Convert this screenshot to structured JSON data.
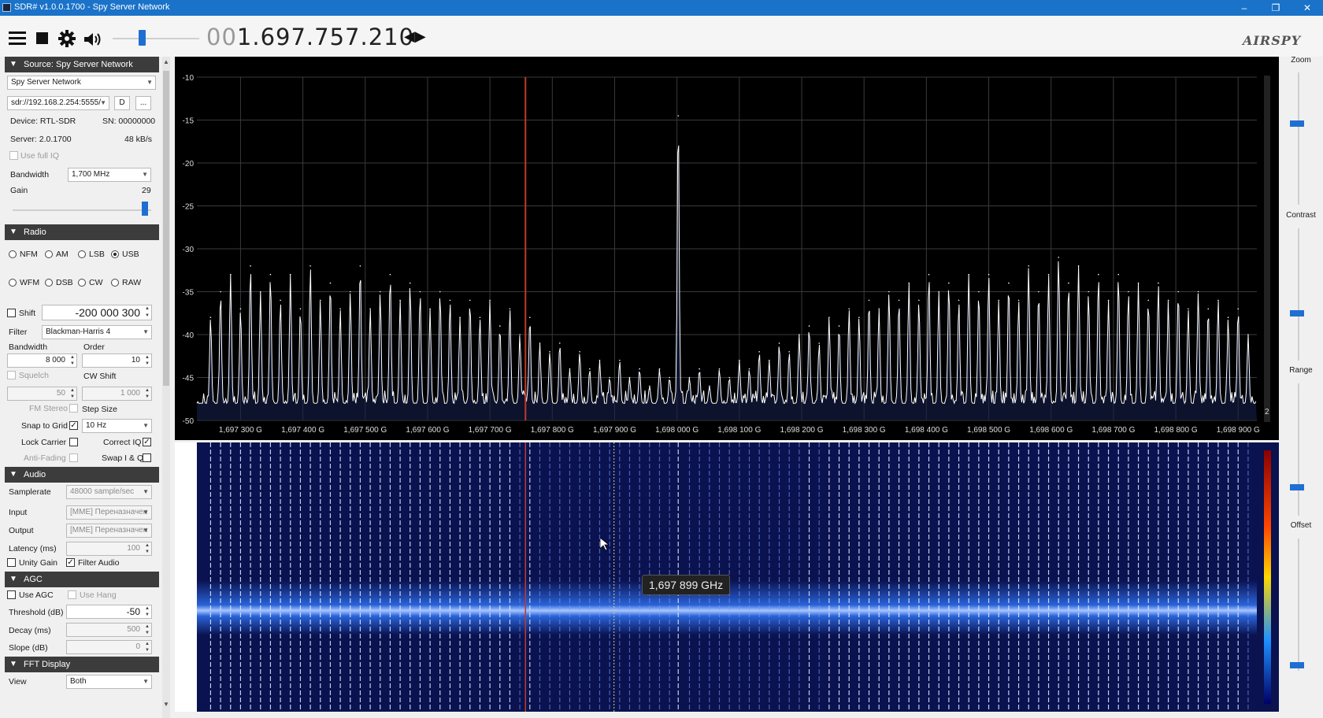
{
  "window": {
    "title": "SDR# v1.0.0.1700 - Spy Server Network"
  },
  "toolbar": {
    "menu_icon": "hamburger-menu-icon",
    "stop_icon": "stop-icon",
    "settings_icon": "gear-icon",
    "audio_icon": "speaker-icon",
    "frequency_prefix": "00",
    "frequency_main": "1.697.757.210",
    "logo": "AIRSPY"
  },
  "source": {
    "header": "Source: Spy Server Network",
    "selected": "Spy Server Network",
    "uri": "sdr://192.168.2.254:5555/",
    "d_button": "D",
    "more_button": "...",
    "device": "Device: RTL-SDR",
    "serial": "SN: 00000000",
    "server": "Server: 2.0.1700",
    "rate": "48 kB/s",
    "use_full_iq": "Use full IQ",
    "bandwidth_label": "Bandwidth",
    "bandwidth_value": "1,700 MHz",
    "gain_label": "Gain",
    "gain_value": "29",
    "gain_fraction": 0.93
  },
  "radio": {
    "header": "Radio",
    "modes_row1": [
      "NFM",
      "AM",
      "LSB",
      "USB"
    ],
    "modes_row2": [
      "WFM",
      "DSB",
      "CW",
      "RAW"
    ],
    "selected_mode": "USB",
    "shift_label": "Shift",
    "shift_value": "-200 000 300",
    "filter_label": "Filter",
    "filter_value": "Blackman-Harris 4",
    "bandwidth_label": "Bandwidth",
    "bandwidth_value": "8 000",
    "order_label": "Order",
    "order_value": "10",
    "squelch_label": "Squelch",
    "squelch_value": "50",
    "cw_shift_label": "CW Shift",
    "cw_shift_value": "1 000",
    "fm_stereo": "FM Stereo",
    "step_size": "Step Size",
    "snap_to_grid": "Snap to Grid",
    "step_value": "10 Hz",
    "lock_carrier": "Lock Carrier",
    "correct_iq": "Correct IQ",
    "anti_fading": "Anti-Fading",
    "swap_iq": "Swap I & Q"
  },
  "audio": {
    "header": "Audio",
    "samplerate_label": "Samplerate",
    "samplerate_value": "48000 sample/sec",
    "input_label": "Input",
    "input_value": "[MME] Переназначен",
    "output_label": "Output",
    "output_value": "[MME] Переназначен",
    "latency_label": "Latency (ms)",
    "latency_value": "100",
    "unity_gain": "Unity Gain",
    "filter_audio": "Filter Audio"
  },
  "agc": {
    "header": "AGC",
    "use_agc": "Use AGC",
    "use_hang": "Use Hang",
    "threshold_label": "Threshold (dB)",
    "threshold_value": "-50",
    "decay_label": "Decay (ms)",
    "decay_value": "500",
    "slope_label": "Slope (dB)",
    "slope_value": "0"
  },
  "fft": {
    "header": "FFT Display",
    "view_label": "View",
    "view_value": "Both"
  },
  "right_panel": {
    "zoom": "Zoom",
    "contrast": "Contrast",
    "range": "Range",
    "offset": "Offset",
    "zoom_level": 0.62,
    "contrast_level": 0.35,
    "range_level": 0.2,
    "offset_level": 0.02
  },
  "spectrum": {
    "scale_marker": "2",
    "tooltip": "1,697 899 GHz"
  },
  "chart_data": {
    "type": "line",
    "title": "",
    "xlabel": "",
    "ylabel": "",
    "ylim": [
      -50,
      -10
    ],
    "xlim": [
      1697.23,
      1698.93
    ],
    "yticks": [
      "-10",
      "-15",
      "-20",
      "-25",
      "-30",
      "-35",
      "-40",
      "-45",
      "-50"
    ],
    "xticks": [
      "1,697 300 G",
      "1,697 400 G",
      "1,697 500 G",
      "1,697 600 G",
      "1,697 700 G",
      "1,697 800 G",
      "1,697 900 G",
      "1,698 000 G",
      "1,698 100 G",
      "1,698 200 G",
      "1,698 300 G",
      "1,698 400 G",
      "1,698 500 G",
      "1,698 600 G",
      "1,698 700 G",
      "1,698 800 G",
      "1,698 900 G"
    ],
    "xtick_values": [
      1697.3,
      1697.4,
      1697.5,
      1697.6,
      1697.7,
      1697.8,
      1697.9,
      1698.0,
      1698.1,
      1698.2,
      1698.3,
      1698.4,
      1698.5,
      1698.6,
      1698.7,
      1698.8,
      1698.9
    ],
    "tuned_frequency_mhz": 1697.757,
    "cursor_frequency_mhz": 1697.899,
    "noise_floor_db": -48,
    "grid": true,
    "peaks": [
      {
        "x": 1697.252,
        "y": -38
      },
      {
        "x": 1697.268,
        "y": -35
      },
      {
        "x": 1697.284,
        "y": -33
      },
      {
        "x": 1697.3,
        "y": -37
      },
      {
        "x": 1697.316,
        "y": -32
      },
      {
        "x": 1697.332,
        "y": -35
      },
      {
        "x": 1697.348,
        "y": -33
      },
      {
        "x": 1697.364,
        "y": -36
      },
      {
        "x": 1697.38,
        "y": -33
      },
      {
        "x": 1697.396,
        "y": -37
      },
      {
        "x": 1697.412,
        "y": -32
      },
      {
        "x": 1697.428,
        "y": -36
      },
      {
        "x": 1697.444,
        "y": -34
      },
      {
        "x": 1697.46,
        "y": -37
      },
      {
        "x": 1697.476,
        "y": -35
      },
      {
        "x": 1697.492,
        "y": -32
      },
      {
        "x": 1697.508,
        "y": -37
      },
      {
        "x": 1697.524,
        "y": -35
      },
      {
        "x": 1697.54,
        "y": -33
      },
      {
        "x": 1697.556,
        "y": -36
      },
      {
        "x": 1697.572,
        "y": -34
      },
      {
        "x": 1697.588,
        "y": -35
      },
      {
        "x": 1697.604,
        "y": -37
      },
      {
        "x": 1697.62,
        "y": -35
      },
      {
        "x": 1697.636,
        "y": -36
      },
      {
        "x": 1697.652,
        "y": -38
      },
      {
        "x": 1697.668,
        "y": -36
      },
      {
        "x": 1697.684,
        "y": -38
      },
      {
        "x": 1697.7,
        "y": -36
      },
      {
        "x": 1697.716,
        "y": -39
      },
      {
        "x": 1697.732,
        "y": -37
      },
      {
        "x": 1697.748,
        "y": -40
      },
      {
        "x": 1697.764,
        "y": -38
      },
      {
        "x": 1697.78,
        "y": -41
      },
      {
        "x": 1697.796,
        "y": -42
      },
      {
        "x": 1697.812,
        "y": -41
      },
      {
        "x": 1697.828,
        "y": -44
      },
      {
        "x": 1697.844,
        "y": -42
      },
      {
        "x": 1697.86,
        "y": -44
      },
      {
        "x": 1697.876,
        "y": -43
      },
      {
        "x": 1697.892,
        "y": -45
      },
      {
        "x": 1697.908,
        "y": -43
      },
      {
        "x": 1697.924,
        "y": -45
      },
      {
        "x": 1697.94,
        "y": -44
      },
      {
        "x": 1697.956,
        "y": -46
      },
      {
        "x": 1697.972,
        "y": -44
      },
      {
        "x": 1697.988,
        "y": -45
      },
      {
        "x": 1698.002,
        "y": -14.5
      },
      {
        "x": 1698.02,
        "y": -45
      },
      {
        "x": 1698.036,
        "y": -44
      },
      {
        "x": 1698.052,
        "y": -46
      },
      {
        "x": 1698.068,
        "y": -44
      },
      {
        "x": 1698.084,
        "y": -45
      },
      {
        "x": 1698.1,
        "y": -43
      },
      {
        "x": 1698.116,
        "y": -44
      },
      {
        "x": 1698.132,
        "y": -42
      },
      {
        "x": 1698.148,
        "y": -43
      },
      {
        "x": 1698.164,
        "y": -41
      },
      {
        "x": 1698.18,
        "y": -42
      },
      {
        "x": 1698.196,
        "y": -40
      },
      {
        "x": 1698.212,
        "y": -39
      },
      {
        "x": 1698.228,
        "y": -41
      },
      {
        "x": 1698.244,
        "y": -38
      },
      {
        "x": 1698.26,
        "y": -39
      },
      {
        "x": 1698.276,
        "y": -37
      },
      {
        "x": 1698.292,
        "y": -38
      },
      {
        "x": 1698.308,
        "y": -36
      },
      {
        "x": 1698.324,
        "y": -37
      },
      {
        "x": 1698.34,
        "y": -35
      },
      {
        "x": 1698.356,
        "y": -36
      },
      {
        "x": 1698.372,
        "y": -34
      },
      {
        "x": 1698.388,
        "y": -36
      },
      {
        "x": 1698.404,
        "y": -33
      },
      {
        "x": 1698.42,
        "y": -35
      },
      {
        "x": 1698.436,
        "y": -34
      },
      {
        "x": 1698.452,
        "y": -36
      },
      {
        "x": 1698.468,
        "y": -33
      },
      {
        "x": 1698.484,
        "y": -35
      },
      {
        "x": 1698.5,
        "y": -33
      },
      {
        "x": 1698.516,
        "y": -36
      },
      {
        "x": 1698.532,
        "y": -34
      },
      {
        "x": 1698.548,
        "y": -36
      },
      {
        "x": 1698.564,
        "y": -32
      },
      {
        "x": 1698.58,
        "y": -35
      },
      {
        "x": 1698.596,
        "y": -33
      },
      {
        "x": 1698.612,
        "y": -31
      },
      {
        "x": 1698.628,
        "y": -34
      },
      {
        "x": 1698.644,
        "y": -32
      },
      {
        "x": 1698.66,
        "y": -35
      },
      {
        "x": 1698.676,
        "y": -33
      },
      {
        "x": 1698.692,
        "y": -36
      },
      {
        "x": 1698.708,
        "y": -33
      },
      {
        "x": 1698.724,
        "y": -35
      },
      {
        "x": 1698.74,
        "y": -34
      },
      {
        "x": 1698.756,
        "y": -36
      },
      {
        "x": 1698.772,
        "y": -34
      },
      {
        "x": 1698.788,
        "y": -36
      },
      {
        "x": 1698.804,
        "y": -35
      },
      {
        "x": 1698.82,
        "y": -37
      },
      {
        "x": 1698.836,
        "y": -35
      },
      {
        "x": 1698.852,
        "y": -37
      },
      {
        "x": 1698.868,
        "y": -36
      },
      {
        "x": 1698.884,
        "y": -38
      },
      {
        "x": 1698.9,
        "y": -37
      },
      {
        "x": 1698.916,
        "y": -40
      }
    ]
  },
  "colors": {
    "accent": "#1f6fd1",
    "titlebar": "#1a72c9",
    "section_header": "#3c3c3c",
    "spectrum_bg": "#000000",
    "spectrum_line": "#ffffff",
    "grid": "#3a3a3a",
    "tuned_marker": "#c0392b",
    "waterfall_bg": "#0a1250"
  }
}
